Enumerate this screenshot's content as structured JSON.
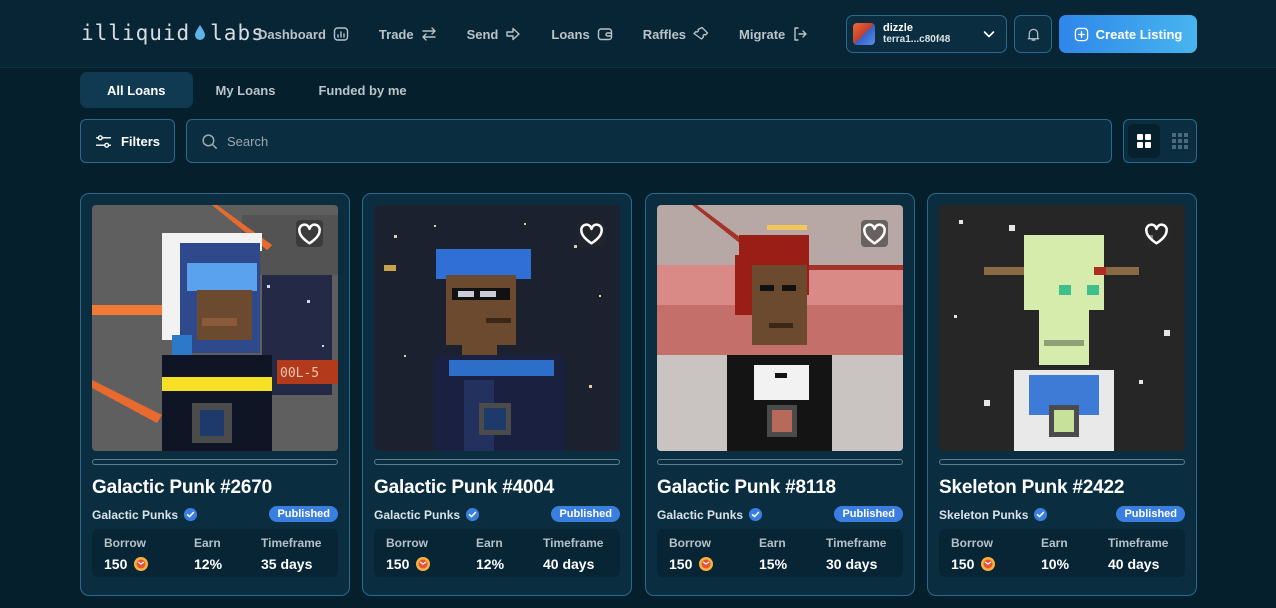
{
  "header": {
    "logo_left": "illiquid",
    "logo_right": "labs",
    "nav": [
      {
        "label": "Dashboard",
        "icon": "dashboard-icon"
      },
      {
        "label": "Trade",
        "icon": "swap-icon"
      },
      {
        "label": "Send",
        "icon": "arrow-right-icon"
      },
      {
        "label": "Loans",
        "icon": "wallet-icon"
      },
      {
        "label": "Raffles",
        "icon": "ticket-icon"
      },
      {
        "label": "Migrate",
        "icon": "logout-icon"
      }
    ],
    "wallet": {
      "name": "dizzle",
      "address": "terra1...c80f48"
    },
    "create_label": "Create Listing"
  },
  "tabs": [
    {
      "label": "All Loans",
      "active": true
    },
    {
      "label": "My Loans",
      "active": false
    },
    {
      "label": "Funded by me",
      "active": false
    }
  ],
  "filters_label": "Filters",
  "search": {
    "placeholder": "Search",
    "value": ""
  },
  "colors": {
    "accent": "#3a7fe0",
    "background": "#061f2d",
    "card": "#0a2d40",
    "border": "#2a6b8c"
  },
  "stat_labels": {
    "borrow": "Borrow",
    "earn": "Earn",
    "timeframe": "Timeframe"
  },
  "cards": [
    {
      "title": "Galactic Punk #2670",
      "collection": "Galactic Punks",
      "status": "Published",
      "borrow": "150",
      "earn": "12%",
      "timeframe": "35 days",
      "sign_text": "00L-5"
    },
    {
      "title": "Galactic Punk #4004",
      "collection": "Galactic Punks",
      "status": "Published",
      "borrow": "150",
      "earn": "12%",
      "timeframe": "40 days"
    },
    {
      "title": "Galactic Punk #8118",
      "collection": "Galactic Punks",
      "status": "Published",
      "borrow": "150",
      "earn": "15%",
      "timeframe": "30 days"
    },
    {
      "title": "Skeleton Punk #2422",
      "collection": "Skeleton Punks",
      "status": "Published",
      "borrow": "150",
      "earn": "10%",
      "timeframe": "40 days"
    }
  ]
}
